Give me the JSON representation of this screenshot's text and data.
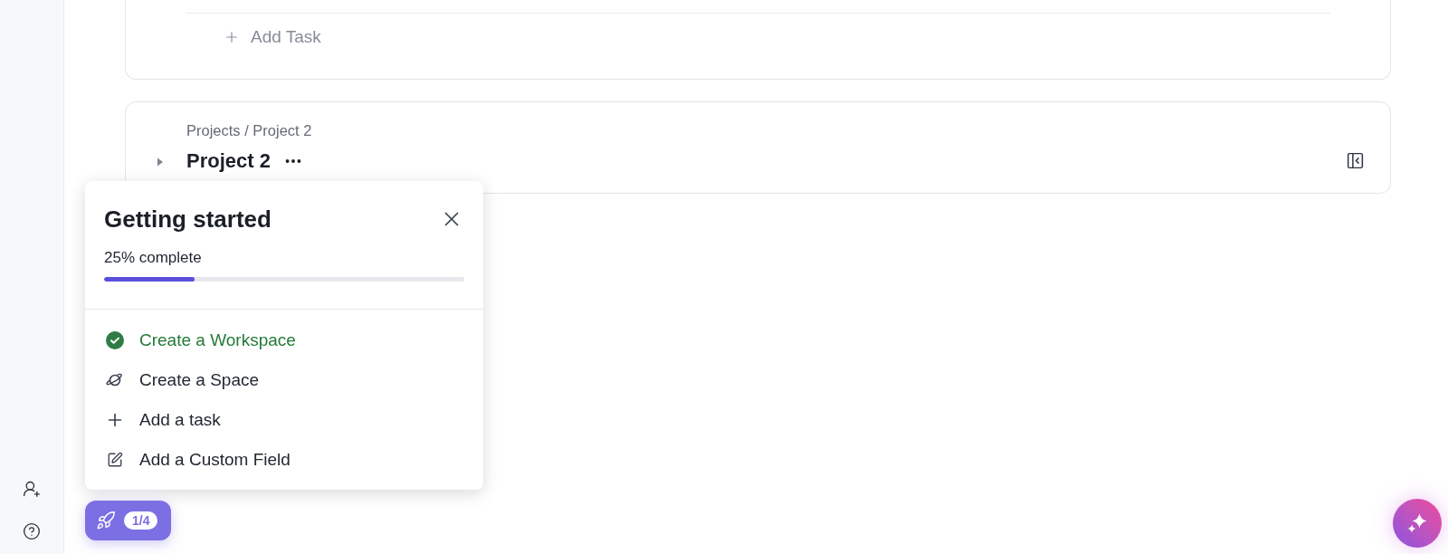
{
  "task_list": {
    "add_task": "Add Task"
  },
  "project": {
    "breadcrumb": "Projects / Project 2",
    "title": "Project 2",
    "expanded": false
  },
  "getting_started": {
    "title": "Getting started",
    "progress_label": "25% complete",
    "level": 0.25,
    "steps": [
      {
        "label": "Create a Workspace",
        "completed": true
      },
      {
        "label": "Create a Space",
        "kind": "space",
        "completed": false
      },
      {
        "label": "Add a task",
        "kind": "task",
        "completed": false
      },
      {
        "label": "Add a Custom Field",
        "kind": "custom_field",
        "completed": false
      }
    ]
  },
  "launcher": {
    "count": "1/4"
  }
}
